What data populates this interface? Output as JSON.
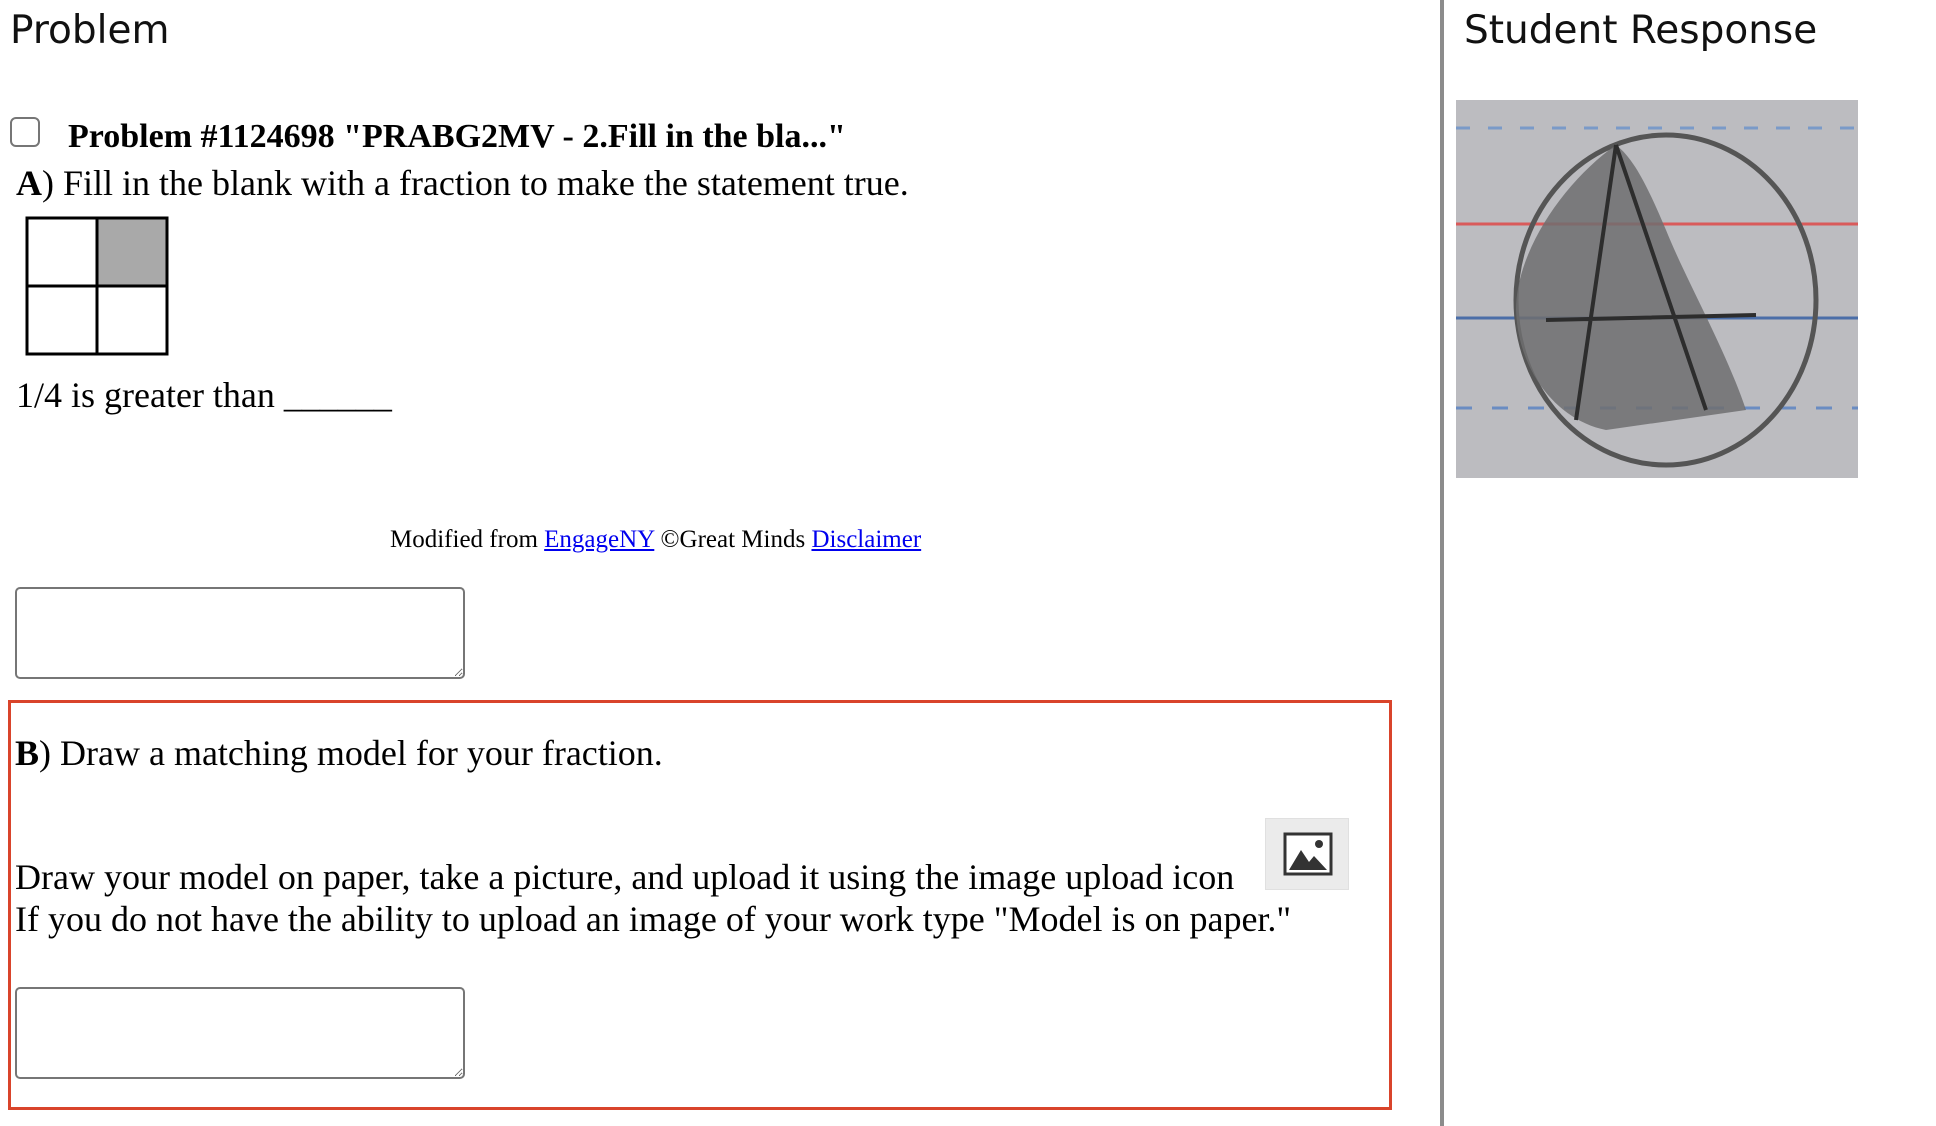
{
  "left_pane": {
    "title": "Problem",
    "problem_header": "Problem #1124698 \"PRABG2MV - 2.Fill in the bla...\"",
    "part_a": {
      "label": "A",
      "prompt": ") Fill in the blank with a fraction to make the statement true.",
      "statement": "1/4 is greater than ______"
    },
    "credit": {
      "prefix": "Modified from ",
      "link1": "EngageNY",
      "middle": " ©Great Minds ",
      "link2": "Disclaimer"
    },
    "part_b": {
      "label": "B",
      "prompt": ") Draw a matching model for your fraction.",
      "instruction_1": "Draw your model on paper, take a picture, and upload it using the image upload icon",
      "instruction_2": "If you do not have the ability to upload an image of your work type \"Model is on paper.\""
    },
    "answer_a_value": "",
    "answer_b_value": ""
  },
  "right_pane": {
    "title": "Student Response"
  },
  "colors": {
    "highlight_border": "#d9442b",
    "divider": "#8c8c8c",
    "link": "#0000ee",
    "shaded_cell": "#a9a9a9"
  },
  "icons": {
    "upload": "image-upload-icon"
  }
}
